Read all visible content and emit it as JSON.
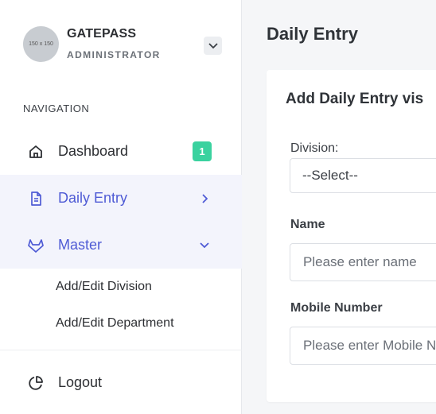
{
  "profile": {
    "avatar_text": "150 x 150",
    "name": "GATEPASS",
    "role": "ADMINISTRATOR"
  },
  "nav": {
    "heading": "NAVIGATION",
    "dashboard": {
      "label": "Dashboard",
      "badge": "1"
    },
    "daily_entry": {
      "label": "Daily Entry"
    },
    "master": {
      "label": "Master",
      "sub_items": [
        "Add/Edit Division",
        "Add/Edit Department"
      ]
    },
    "logout": {
      "label": "Logout"
    }
  },
  "main": {
    "title": "Daily Entry",
    "card_title": "Add Daily Entry vis",
    "division": {
      "label": "Division:",
      "selected": "--Select--"
    },
    "name": {
      "label": "Name",
      "placeholder": "Please enter name"
    },
    "mobile": {
      "label": "Mobile Number",
      "placeholder": "Please enter Mobile N"
    }
  },
  "colors": {
    "accent": "#4f5bd5",
    "badge": "#3ad29f",
    "active_bg": "#f3f4fc"
  },
  "icons": {
    "dashboard": "home-icon",
    "daily_entry": "document-icon",
    "master": "gitlab-icon",
    "logout": "pie-chart-icon"
  }
}
